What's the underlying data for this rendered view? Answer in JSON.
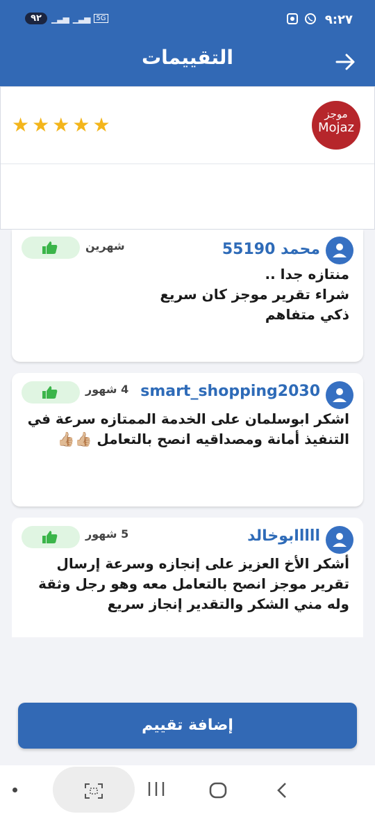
{
  "status_bar": {
    "time": "٩:٢٧",
    "battery": "٩٢",
    "network": "5G"
  },
  "app_bar": {
    "title": "التقييمات",
    "back_icon": "arrow-right-icon"
  },
  "merchant": {
    "logo_ar": "موجز",
    "logo_en": "Mojaz",
    "rating_stars": 5,
    "star_color": "#f3b51b"
  },
  "reviews": [
    {
      "name": "محمد 55190",
      "time": "شهرين",
      "text": "منتازه جدا     ..\n شراء تقرير موجز كان سريع\nذكي متفاهم"
    },
    {
      "name": "smart_shopping2030",
      "time": "4 شهور",
      "text": "اشكر ابوسلمان على الخدمة الممتازه سرعة في التنفيذ أمانة ومصداقيه انصح بالتعامل 👍🏼👍🏼"
    },
    {
      "name": "llllابوخالد",
      "time": "5 شهور",
      "text": "أشكر الأخ العزيز على إنجازه وسرعة إرسال تقرير موجز انصح بالتعامل معه وهو رجل وثقة وله مني الشكر والتقدير إنجاز سريع"
    }
  ],
  "add_review_button": "إضافة تقييم",
  "colors": {
    "primary": "#3269b5",
    "reviewer_name": "#2e6bb8",
    "like_bg": "#e0f5e2",
    "like_icon": "#3bb54a",
    "logo_bg": "#b6262b"
  }
}
